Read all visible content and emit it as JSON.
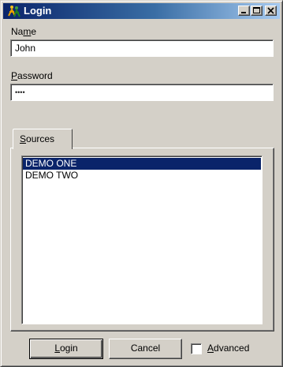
{
  "window": {
    "title": "Login",
    "icon": "people-app-icon",
    "controls": [
      "minimize-icon",
      "maximize-icon",
      "close-icon"
    ]
  },
  "form": {
    "name_label_pre": "Na",
    "name_label_accel": "m",
    "name_label_post": "e",
    "name_value": "John",
    "password_label_accel": "P",
    "password_label_post": "assword",
    "password_value": "••••"
  },
  "sources": {
    "tab_label_accel": "S",
    "tab_label_post": "ources",
    "items": [
      "DEMO ONE",
      "DEMO TWO"
    ],
    "selected": "DEMO ONE"
  },
  "buttons": {
    "login_accel": "L",
    "login_post": "ogin",
    "cancel": "Cancel",
    "advanced_accel": "A",
    "advanced_post": "dvanced",
    "advanced_checked": false
  },
  "colors": {
    "titlebar_start": "#0a246a",
    "titlebar_end": "#a6caf0",
    "selection": "#0a246a",
    "face": "#d4d0c8"
  }
}
